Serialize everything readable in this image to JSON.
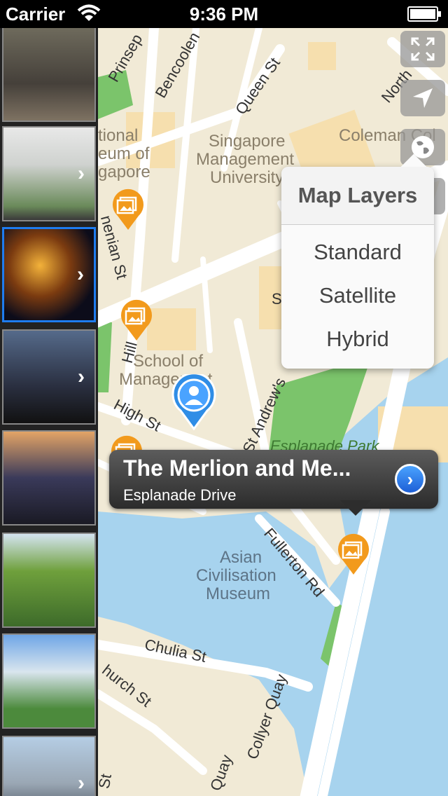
{
  "status_bar": {
    "carrier": "Carrier",
    "time": "9:36 PM"
  },
  "map": {
    "labels": {
      "prinsep": "Prinsep",
      "bencoolen": "Bencoolen",
      "queen_st": "Queen St",
      "north": "North",
      "national_museum_1": "tional",
      "national_museum_2": "eum of",
      "national_museum_3": "gapore",
      "smu_1": "Singapore",
      "smu_2": "Management",
      "smu_3": "University",
      "coleman": "Coleman Col",
      "armenian": "nenian St",
      "hill": "Hill",
      "school_1": "School of",
      "school_2": "Managenent",
      "high_st": "High St",
      "st_andrews": "St Andrew's",
      "s": "S",
      "esplanade_park": "Esplanade Park",
      "asian_1": "Asian",
      "asian_2": "Civilisation",
      "asian_3": "Museum",
      "fullerton": "Fullerton Rd",
      "chulia": "Chulia St",
      "church": "hurch St",
      "collyer": "Collyer Quay",
      "quay": "Quay",
      "st": "St"
    }
  },
  "map_layers": {
    "title": "Map Layers",
    "options": [
      "Standard",
      "Satellite",
      "Hybrid"
    ]
  },
  "callout": {
    "title": "The Merlion and Me...",
    "subtitle": "Esplanade Drive"
  },
  "controls": [
    "fullscreen-icon",
    "location-arrow-icon",
    "globe-icon"
  ],
  "colors": {
    "selected_border": "#1e7cf0",
    "pin_orange": "#f29a1c",
    "user_pin_blue": "#2f8de6",
    "water": "#a7d3ee",
    "park": "#7bc46b"
  }
}
